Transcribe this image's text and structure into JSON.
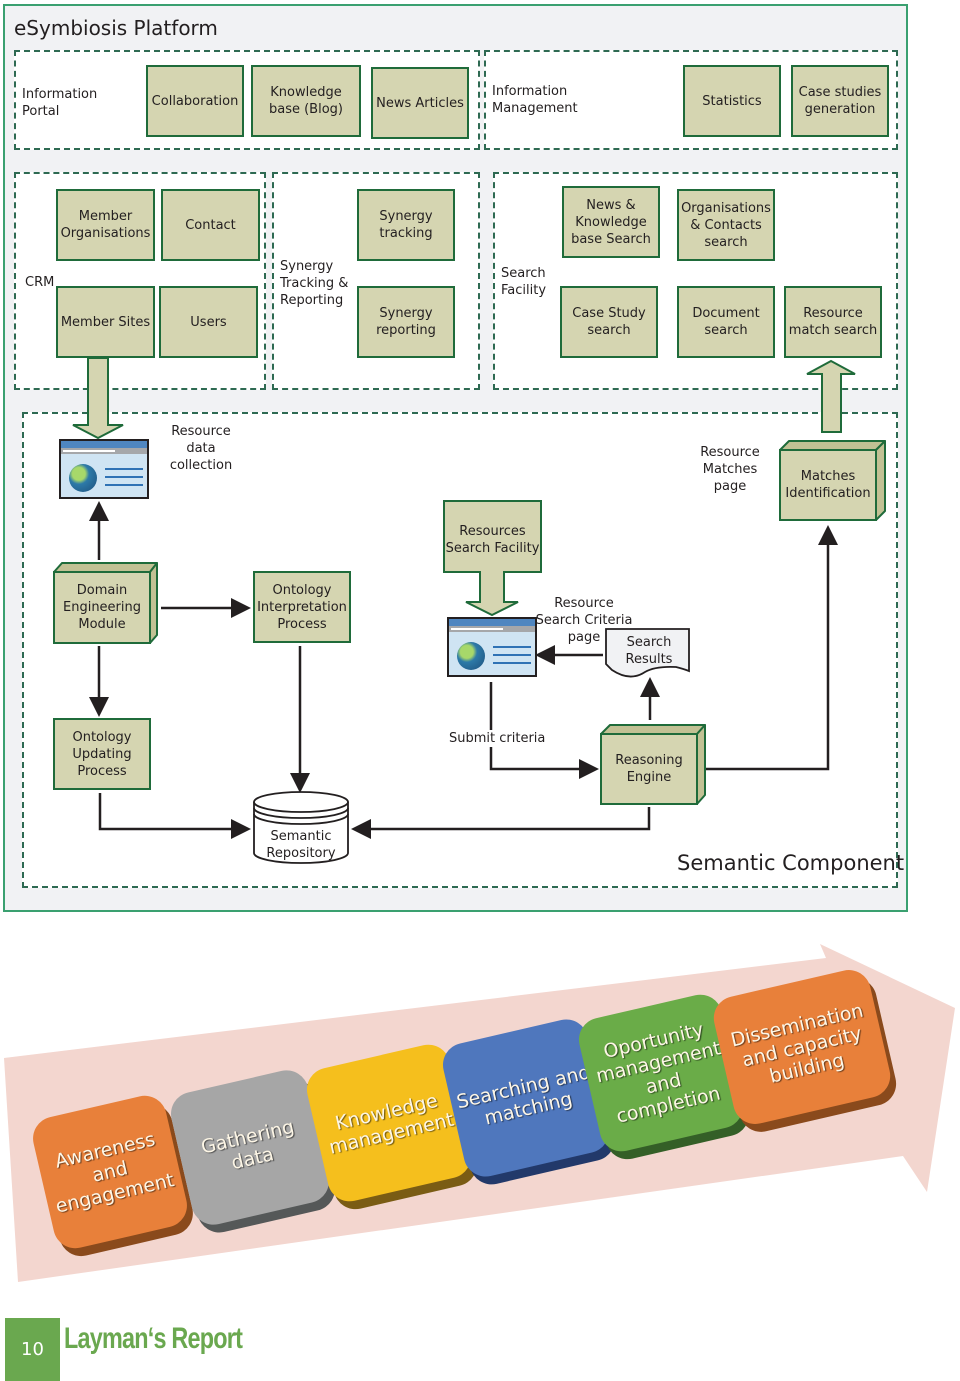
{
  "platform": {
    "title": "eSymbiosis Platform",
    "information_portal": {
      "label": "Information Portal",
      "items": [
        "Collaboration",
        "Knowledge base (Blog)",
        "News Articles"
      ]
    },
    "information_management": {
      "label": "Information Management",
      "items": [
        "Statistics",
        "Case studies generation"
      ]
    },
    "crm": {
      "label": "CRM",
      "items": [
        "Member Organisations",
        "Contact",
        "Member Sites",
        "Users"
      ]
    },
    "synergy": {
      "label": "Synergy Tracking & Reporting",
      "items": [
        "Synergy tracking",
        "Synergy reporting"
      ]
    },
    "search_facility": {
      "label": "Search Facility",
      "items": [
        "News & Knowledge base Search",
        "Organisations & Contacts search",
        "Case Study search",
        "Document search",
        "Resource match search"
      ]
    },
    "semantic": {
      "title": "Semantic Component",
      "resource_data_collection": "Resource data collection",
      "resource_matches_page": "Resource Matches page",
      "matches_identification": "Matches Identification",
      "resources_search_facility": "Resources Search Facility",
      "domain_engineering_module": "Domain Engineering Module",
      "ontology_interpretation_process": "Ontology Interpretation Process",
      "resource_search_criteria_page": "Resource Search Criteria page",
      "search_results": "Search Results",
      "ontology_updating_process": "Ontology Updating Process",
      "submit_criteria": "Submit criteria",
      "reasoning_engine": "Reasoning Engine",
      "semantic_repository": "Semantic Repository"
    }
  },
  "process_flow": {
    "stages": [
      {
        "label": "Awareness and engagement",
        "color": "#e8803a",
        "shadow": "#8a4a1c"
      },
      {
        "label": "Gathering data",
        "color": "#a6a6a6",
        "shadow": "#555858"
      },
      {
        "label": "Knowledge management",
        "color": "#f5bf1d",
        "shadow": "#7a5c14"
      },
      {
        "label": "Searching and matching",
        "color": "#4f77bd",
        "shadow": "#22396a"
      },
      {
        "label": "Oportunity management and completion",
        "color": "#6aac48",
        "shadow": "#345f27"
      },
      {
        "label": "Dissemination and capacity building",
        "color": "#e8803a",
        "shadow": "#8a4a1c"
      }
    ],
    "arrow_color": "#f3d6cf"
  },
  "footer": {
    "page_number": "10",
    "report_title": "Layman‘s Report",
    "accent": "#6aa84f"
  }
}
